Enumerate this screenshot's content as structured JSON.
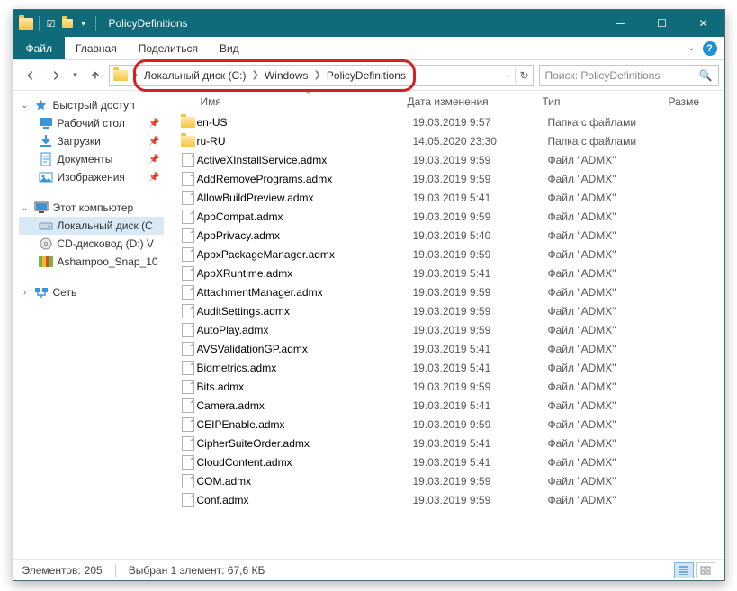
{
  "window": {
    "title": "PolicyDefinitions"
  },
  "tabs": {
    "file": "Файл",
    "home": "Главная",
    "share": "Поделиться",
    "view": "Вид"
  },
  "breadcrumbs": [
    "Локальный диск (C:)",
    "Windows",
    "PolicyDefinitions"
  ],
  "search": {
    "placeholder": "Поиск: PolicyDefinitions"
  },
  "columns": {
    "name": "Имя",
    "date": "Дата изменения",
    "type": "Тип",
    "size": "Разме"
  },
  "tree": {
    "quick": {
      "label": "Быстрый доступ"
    },
    "desktop": {
      "label": "Рабочий стол"
    },
    "downloads": {
      "label": "Загрузки"
    },
    "documents": {
      "label": "Документы"
    },
    "pictures": {
      "label": "Изображения"
    },
    "thispc": {
      "label": "Этот компьютер"
    },
    "localc": {
      "label": "Локальный диск (C"
    },
    "cd": {
      "label": "CD-дисковод (D:) V"
    },
    "ashampoo": {
      "label": "Ashampoo_Snap_10"
    },
    "network": {
      "label": "Сеть"
    }
  },
  "files": [
    {
      "name": "en-US",
      "date": "19.03.2019 9:57",
      "type": "Папка с файлами",
      "icon": "folder"
    },
    {
      "name": "ru-RU",
      "date": "14.05.2020 23:30",
      "type": "Папка с файлами",
      "icon": "folder"
    },
    {
      "name": "ActiveXInstallService.admx",
      "date": "19.03.2019 9:59",
      "type": "Файл \"ADMX\"",
      "icon": "file"
    },
    {
      "name": "AddRemovePrograms.admx",
      "date": "19.03.2019 9:59",
      "type": "Файл \"ADMX\"",
      "icon": "file"
    },
    {
      "name": "AllowBuildPreview.admx",
      "date": "19.03.2019 5:41",
      "type": "Файл \"ADMX\"",
      "icon": "file"
    },
    {
      "name": "AppCompat.admx",
      "date": "19.03.2019 9:59",
      "type": "Файл \"ADMX\"",
      "icon": "file"
    },
    {
      "name": "AppPrivacy.admx",
      "date": "19.03.2019 5:40",
      "type": "Файл \"ADMX\"",
      "icon": "file"
    },
    {
      "name": "AppxPackageManager.admx",
      "date": "19.03.2019 9:59",
      "type": "Файл \"ADMX\"",
      "icon": "file"
    },
    {
      "name": "AppXRuntime.admx",
      "date": "19.03.2019 5:41",
      "type": "Файл \"ADMX\"",
      "icon": "file"
    },
    {
      "name": "AttachmentManager.admx",
      "date": "19.03.2019 9:59",
      "type": "Файл \"ADMX\"",
      "icon": "file"
    },
    {
      "name": "AuditSettings.admx",
      "date": "19.03.2019 9:59",
      "type": "Файл \"ADMX\"",
      "icon": "file"
    },
    {
      "name": "AutoPlay.admx",
      "date": "19.03.2019 9:59",
      "type": "Файл \"ADMX\"",
      "icon": "file"
    },
    {
      "name": "AVSValidationGP.admx",
      "date": "19.03.2019 5:41",
      "type": "Файл \"ADMX\"",
      "icon": "file"
    },
    {
      "name": "Biometrics.admx",
      "date": "19.03.2019 5:41",
      "type": "Файл \"ADMX\"",
      "icon": "file"
    },
    {
      "name": "Bits.admx",
      "date": "19.03.2019 9:59",
      "type": "Файл \"ADMX\"",
      "icon": "file"
    },
    {
      "name": "Camera.admx",
      "date": "19.03.2019 5:41",
      "type": "Файл \"ADMX\"",
      "icon": "file"
    },
    {
      "name": "CEIPEnable.admx",
      "date": "19.03.2019 9:59",
      "type": "Файл \"ADMX\"",
      "icon": "file"
    },
    {
      "name": "CipherSuiteOrder.admx",
      "date": "19.03.2019 5:41",
      "type": "Файл \"ADMX\"",
      "icon": "file"
    },
    {
      "name": "CloudContent.admx",
      "date": "19.03.2019 5:41",
      "type": "Файл \"ADMX\"",
      "icon": "file"
    },
    {
      "name": "COM.admx",
      "date": "19.03.2019 9:59",
      "type": "Файл \"ADMX\"",
      "icon": "file"
    },
    {
      "name": "Conf.admx",
      "date": "19.03.2019 9:59",
      "type": "Файл \"ADMX\"",
      "icon": "file"
    }
  ],
  "status": {
    "count_label": "Элементов:",
    "count": "205",
    "sel_label": "Выбран 1 элемент: 67,6 КБ"
  }
}
